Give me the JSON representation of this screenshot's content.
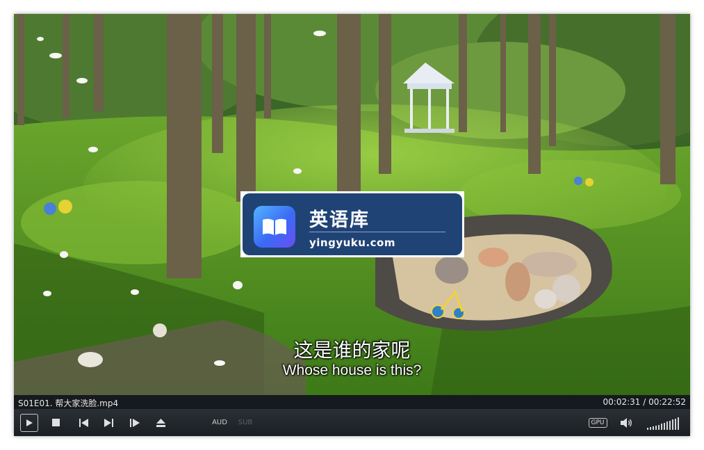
{
  "watermark": {
    "title": "英语库",
    "subtitle": "yingyuku.com"
  },
  "subtitles": {
    "chinese": "这是谁的家呢",
    "english": "Whose house is this?"
  },
  "info": {
    "filename": "S01E01. 帮大家洗脸.mp4",
    "time": "00:02:31 / 00:22:52"
  },
  "controls": {
    "aud_label": "AUD",
    "sub_label": "SUB",
    "gpu_label": "GPU"
  },
  "icons": [
    "play-icon",
    "stop-icon",
    "previous-icon",
    "next-icon",
    "frame-step-icon",
    "eject-icon",
    "volume-icon",
    "book-icon"
  ],
  "colors": {
    "watermark_bg": "#1f4375",
    "control_bar": "#22272c",
    "info_bar": "#161a1e"
  }
}
